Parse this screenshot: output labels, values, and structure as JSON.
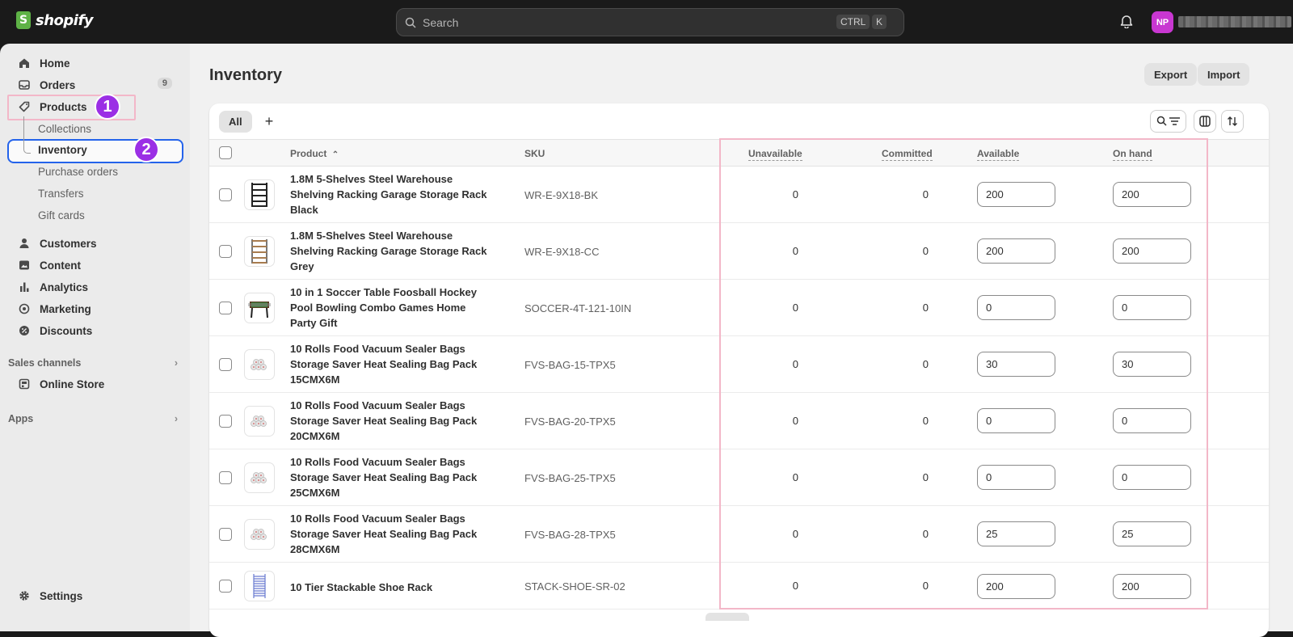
{
  "topbar": {
    "logo_text": "shopify",
    "search_placeholder": "Search",
    "shortcut_ctrl": "CTRL",
    "shortcut_key": "K",
    "avatar_initials": "NP",
    "avatar_color": "#c837d1"
  },
  "sidebar": {
    "items": [
      {
        "label": "Home",
        "icon": "home-icon"
      },
      {
        "label": "Orders",
        "icon": "inbox-icon",
        "badge": "9"
      },
      {
        "label": "Products",
        "icon": "tag-icon"
      }
    ],
    "product_sub": [
      "Collections",
      "Inventory",
      "Purchase orders",
      "Transfers",
      "Gift cards"
    ],
    "items2": [
      {
        "label": "Customers",
        "icon": "person-icon"
      },
      {
        "label": "Content",
        "icon": "image-icon"
      },
      {
        "label": "Analytics",
        "icon": "chart-bar-icon"
      },
      {
        "label": "Marketing",
        "icon": "target-icon"
      },
      {
        "label": "Discounts",
        "icon": "discount-icon"
      }
    ],
    "sales_channels_label": "Sales channels",
    "online_store_label": "Online Store",
    "apps_label": "Apps",
    "settings_label": "Settings",
    "step1": "1",
    "step2": "2"
  },
  "main": {
    "title": "Inventory",
    "export_label": "Export",
    "import_label": "Import",
    "tab_all": "All",
    "tab_add": "+",
    "columns": {
      "product": "Product",
      "sku": "SKU",
      "unavailable": "Unavailable",
      "committed": "Committed",
      "available": "Available",
      "on_hand": "On hand"
    },
    "rows": [
      {
        "name": "1.8M 5-Shelves Steel Warehouse Shelving Racking Garage Storage Rack Black",
        "sku": "WR-E-9X18-BK",
        "unavailable": "0",
        "committed": "0",
        "available": "200",
        "on_hand": "200"
      },
      {
        "name": "1.8M 5-Shelves Steel Warehouse Shelving Racking Garage Storage Rack Grey",
        "sku": "WR-E-9X18-CC",
        "unavailable": "0",
        "committed": "0",
        "available": "200",
        "on_hand": "200"
      },
      {
        "name": "10 in 1 Soccer Table Foosball Hockey Pool Bowling Combo Games Home Party Gift",
        "sku": "SOCCER-4T-121-10IN",
        "unavailable": "0",
        "committed": "0",
        "available": "0",
        "on_hand": "0"
      },
      {
        "name": "10 Rolls Food Vacuum Sealer Bags Storage Saver Heat Sealing Bag Pack 15CMX6M",
        "sku": "FVS-BAG-15-TPX5",
        "unavailable": "0",
        "committed": "0",
        "available": "30",
        "on_hand": "30"
      },
      {
        "name": "10 Rolls Food Vacuum Sealer Bags Storage Saver Heat Sealing Bag Pack 20CMX6M",
        "sku": "FVS-BAG-20-TPX5",
        "unavailable": "0",
        "committed": "0",
        "available": "0",
        "on_hand": "0"
      },
      {
        "name": "10 Rolls Food Vacuum Sealer Bags Storage Saver Heat Sealing Bag Pack 25CMX6M",
        "sku": "FVS-BAG-25-TPX5",
        "unavailable": "0",
        "committed": "0",
        "available": "0",
        "on_hand": "0"
      },
      {
        "name": "10 Rolls Food Vacuum Sealer Bags Storage Saver Heat Sealing Bag Pack 28CMX6M",
        "sku": "FVS-BAG-28-TPX5",
        "unavailable": "0",
        "committed": "0",
        "available": "25",
        "on_hand": "25"
      },
      {
        "name": "10 Tier Stackable Shoe Rack",
        "sku": "STACK-SHOE-SR-02",
        "unavailable": "0",
        "committed": "0",
        "available": "200",
        "on_hand": "200"
      }
    ]
  }
}
